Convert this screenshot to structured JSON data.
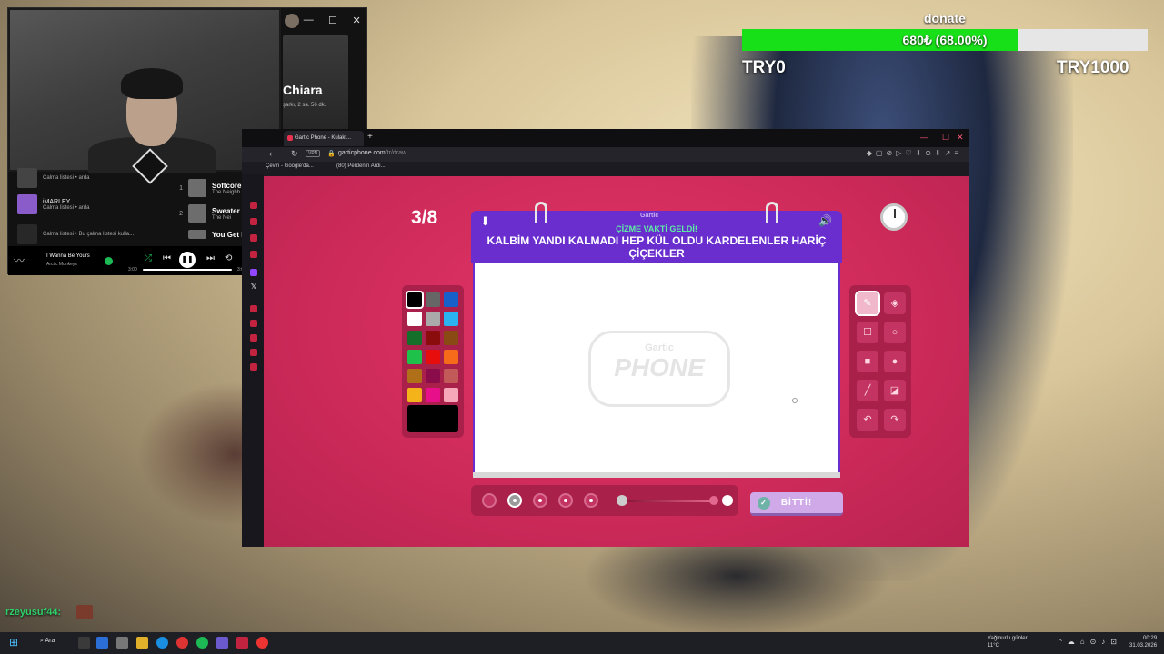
{
  "spotify": {
    "window_controls": [
      "—",
      "☐",
      "✕"
    ],
    "playlist_name": "Chiara",
    "playlist_meta": "şarkı, 2 sa. 56 dk.",
    "library": [
      {
        "title": "",
        "subtitle": "Çalma listesi • arda"
      },
      {
        "title": "iMARLEY",
        "subtitle": "Çalma listesi • arda"
      },
      {
        "title": "",
        "subtitle": "Çalma listesi • Bu çalma listesi kulla..."
      }
    ],
    "tracks": [
      {
        "no": "1",
        "title": "Softcore",
        "artist": "The Neighb"
      },
      {
        "no": "2",
        "title": "Sweater W",
        "artist": "The Nei"
      },
      {
        "no": "",
        "title": "You Get M",
        "artist": ""
      }
    ],
    "now_playing": {
      "title": "I Wanna Be Yours",
      "artist": "Arctic Monkeys",
      "time_current": "3:00",
      "time_total": "3:0"
    }
  },
  "donate": {
    "label": "donate",
    "progress_text": "680₺ (68.00%)",
    "progress_fraction": 0.68,
    "min": "TRY0",
    "max": "TRY1000",
    "fill_color": "#18e018"
  },
  "browser": {
    "tab_title": "Gartic Phone - Kulakt...",
    "new_tab": "+",
    "vpn": "VPN",
    "url_domain": "garticphone.com",
    "url_path": "/tr/draw",
    "bookmarks": [
      "Çeviri - Google'da...",
      "(80) Perdenin Ardı..."
    ]
  },
  "game": {
    "round": "3/8",
    "brand_tag": "Gartic",
    "prompt_subtitle": "ÇİZME VAKTİ GELDİ!",
    "prompt": "KALBİM YANDI KALMADI HEP KÜL OLDU KARDELENLER HARİÇ ÇİÇEKLER",
    "watermark_small": "Gartic",
    "watermark_big": "PHONE",
    "done_button": "BİTTİ!",
    "palette": [
      "#000000",
      "#666666",
      "#1560c9",
      "#ffffff",
      "#aaaaaa",
      "#2ab3f0",
      "#136f2a",
      "#8a0c0c",
      "#8a4a14",
      "#1ec24a",
      "#e80d0d",
      "#f56b1a",
      "#b0701a",
      "#8a0c4a",
      "#c25a5a",
      "#f5b31a",
      "#e8108a",
      "#f7a8b8"
    ],
    "tools": [
      "pencil-icon",
      "eraser-icon",
      "square-outline-icon",
      "circle-outline-icon",
      "square-filled-icon",
      "circle-filled-icon",
      "line-icon",
      "fill-bucket-icon",
      "undo-icon",
      "redo-icon"
    ]
  },
  "chat": {
    "username": "rzeyusuf44:"
  },
  "taskbar": {
    "search": "Ara",
    "weather_line1": "Yağmurlu günler...",
    "weather_line2": "11°C",
    "time": "00:29",
    "date": "31.03.2026"
  }
}
